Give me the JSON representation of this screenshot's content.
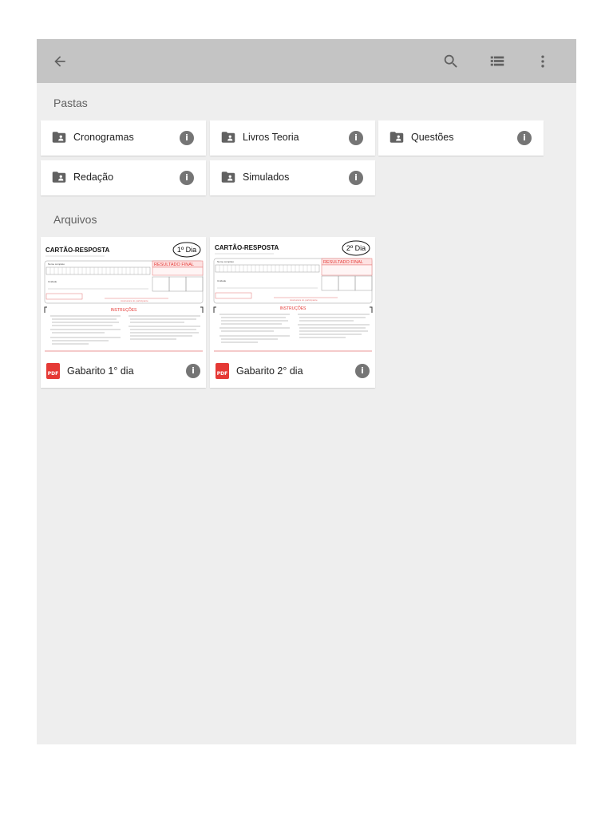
{
  "toolbar": {
    "back_icon": "arrow-left-icon",
    "search_icon": "search-icon",
    "view_icon": "list-view-icon",
    "more_icon": "more-vert-icon"
  },
  "sections": {
    "folders_title": "Pastas",
    "files_title": "Arquivos"
  },
  "folders": [
    {
      "label": "Cronogramas"
    },
    {
      "label": "Livros Teoria"
    },
    {
      "label": "Questões"
    },
    {
      "label": "Redação"
    },
    {
      "label": "Simulados"
    }
  ],
  "files": [
    {
      "label": "Gabarito 1° dia",
      "type": "PDF",
      "thumb": {
        "title": "CARTÃO-RESPOSTA",
        "day": "1º Dia",
        "result": "RESULTADO FINAL",
        "instructions": "INSTRUÇÕES",
        "field_name": "Nome completo",
        "field_unit": "Unidade",
        "signature": "Assinatura do participante"
      }
    },
    {
      "label": "Gabarito 2° dia",
      "type": "PDF",
      "thumb": {
        "title": "CARTÃO-RESPOSTA",
        "day": "2º Dia",
        "result": "RESULTADO FINAL",
        "instructions": "INSTRUÇÕES",
        "field_name": "Nome completo",
        "field_unit": "Unidade",
        "signature": "Assinatura do participante"
      }
    }
  ],
  "colors": {
    "appbar": "#c4c4c4",
    "background": "#eeeeee",
    "card": "#ffffff",
    "icon": "#616161",
    "pdf": "#e53935"
  }
}
